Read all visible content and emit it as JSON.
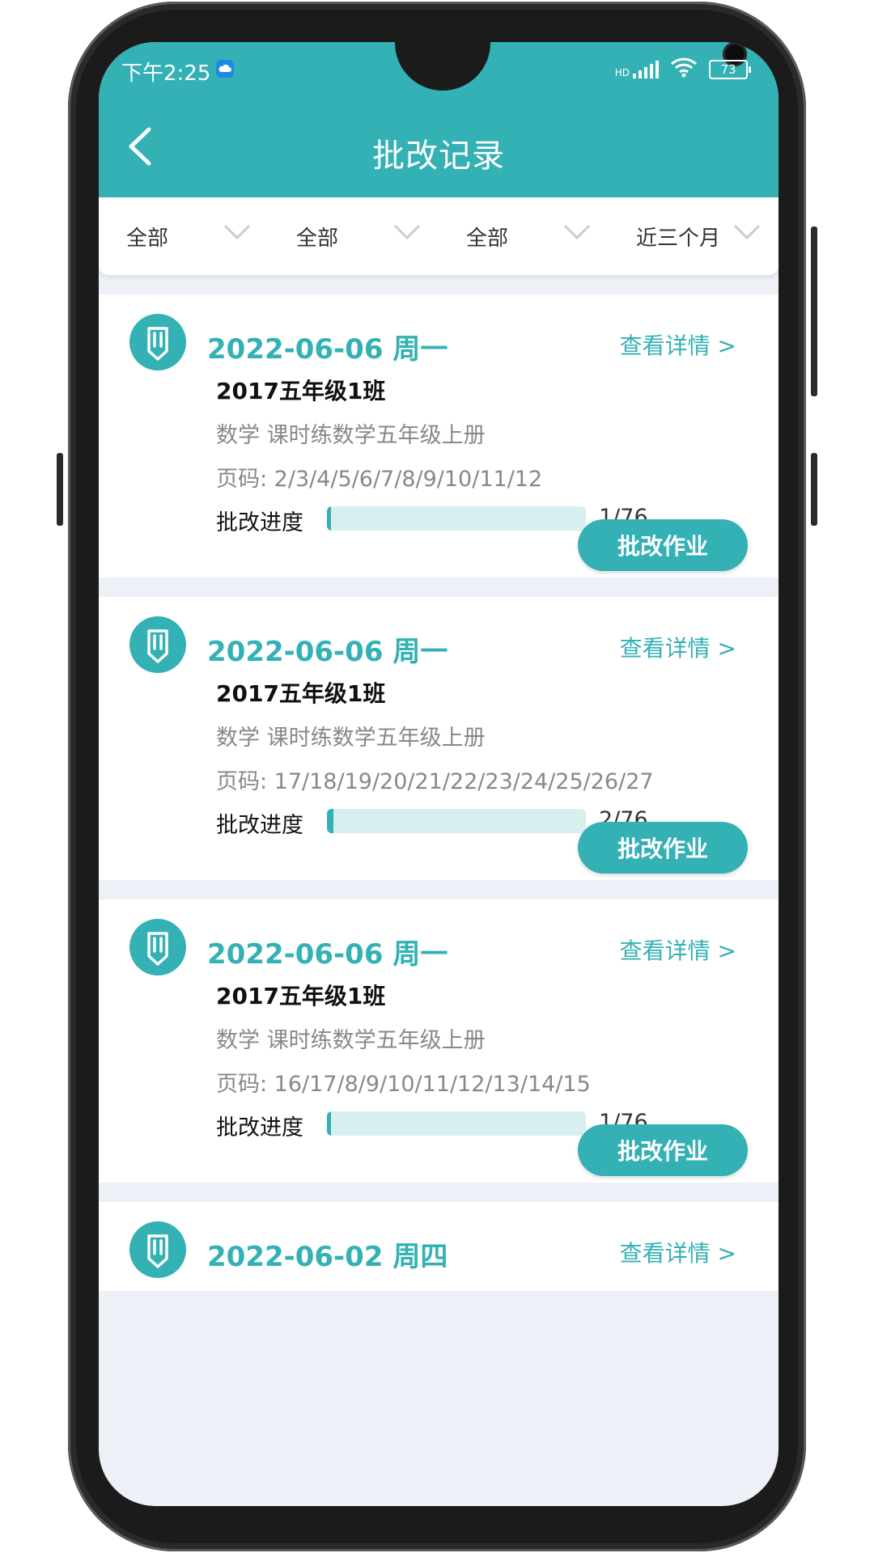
{
  "status_bar": {
    "time": "下午2:25",
    "signal_label": "HD",
    "battery": "73"
  },
  "header": {
    "title": "批改记录"
  },
  "filters": [
    {
      "label": "全部"
    },
    {
      "label": "全部"
    },
    {
      "label": "全部"
    },
    {
      "label": "近三个月"
    }
  ],
  "records": [
    {
      "date": "2022-06-06 周一",
      "detail_link": "查看详情 >",
      "class": "2017五年级1班",
      "subject": "数学 课时练数学五年级上册",
      "pages": "页码: 2/3/4/5/6/7/8/9/10/11/12",
      "progress_label": "批改进度",
      "progress_text": "1/76",
      "progress_fraction": 0.013,
      "button": "批改作业"
    },
    {
      "date": "2022-06-06 周一",
      "detail_link": "查看详情 >",
      "class": "2017五年级1班",
      "subject": "数学 课时练数学五年级上册",
      "pages": "页码: 17/18/19/20/21/22/23/24/25/26/27",
      "progress_label": "批改进度",
      "progress_text": "2/76",
      "progress_fraction": 0.026,
      "button": "批改作业"
    },
    {
      "date": "2022-06-06 周一",
      "detail_link": "查看详情 >",
      "class": "2017五年级1班",
      "subject": "数学 课时练数学五年级上册",
      "pages": "页码: 16/17/8/9/10/11/12/13/14/15",
      "progress_label": "批改进度",
      "progress_text": "1/76",
      "progress_fraction": 0.013,
      "button": "批改作业"
    },
    {
      "date": "2022-06-02 周四",
      "detail_link": "查看详情 >"
    }
  ],
  "colors": {
    "accent": "#33b1b5",
    "progress_track": "#d8efef",
    "page_bg": "#eef0f7"
  }
}
